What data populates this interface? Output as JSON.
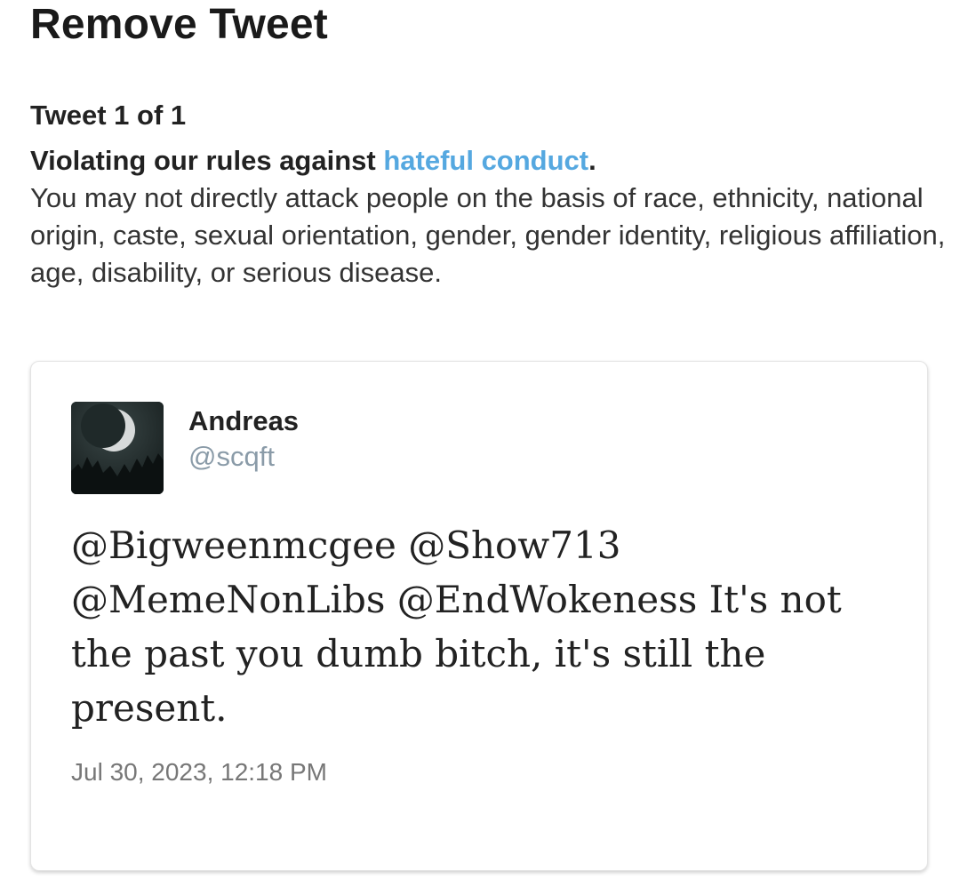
{
  "header": {
    "title": "Remove Tweet"
  },
  "notice": {
    "counter": "Tweet 1 of 1",
    "violation_prefix": "Violating our rules against ",
    "violation_link": "hateful conduct",
    "violation_suffix": ".",
    "description": "You may not directly attack people on the basis of race, ethnicity, national origin, caste, sexual orientation, gender, gender identity, religious affiliation, age, disability, or serious disease."
  },
  "tweet": {
    "author_name": "Andreas",
    "author_handle": "@scqft",
    "text": "@Bigweenmcgee @Show713 @MemeNonLibs @EndWokeness It's not the past you dumb bitch, it's still the present.",
    "timestamp": "Jul 30, 2023, 12:18 PM",
    "avatar_icon": "moon-night-avatar"
  },
  "colors": {
    "link": "#55a8e0",
    "handle": "#8a9ba8",
    "timestamp": "#777777"
  }
}
